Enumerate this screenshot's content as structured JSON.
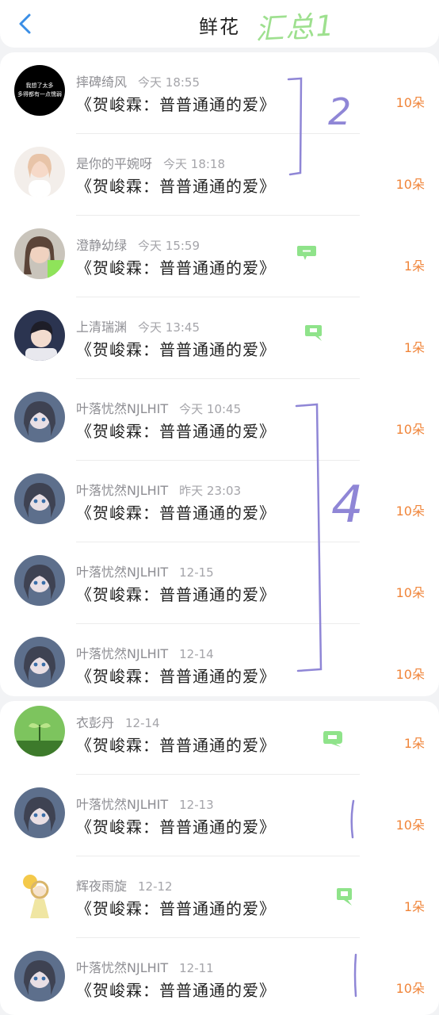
{
  "header": {
    "title": "鲜花",
    "back_icon": "chevron-left-icon",
    "annotation": "汇总1"
  },
  "annotations": {
    "group1": "2",
    "group2": "4",
    "single1": "1",
    "single2": "1"
  },
  "items": [
    {
      "name": "摔碑绮风",
      "time": "今天 18:55",
      "title": "《贺峻霖：普普通通的爱》",
      "count": "10朵",
      "avatar_text": "我想了太多\n多得都有一点懦弱",
      "chat_icon": false
    },
    {
      "name": "是你的平婉呀",
      "time": "今天 18:18",
      "title": "《贺峻霖：普普通通的爱》",
      "count": "10朵",
      "chat_icon": false
    },
    {
      "name": "澄静幼绿",
      "time": "今天 15:59",
      "title": "《贺峻霖：普普通通的爱》",
      "count": "1朵",
      "chat_icon": true
    },
    {
      "name": "上清瑞渊",
      "time": "今天 13:45",
      "title": "《贺峻霖：普普通通的爱》",
      "count": "1朵",
      "chat_icon": true
    },
    {
      "name": "叶落忧然NJLHIT",
      "time": "今天 10:45",
      "title": "《贺峻霖：普普通通的爱》",
      "count": "10朵",
      "chat_icon": false
    },
    {
      "name": "叶落忧然NJLHIT",
      "time": "昨天 23:03",
      "title": "《贺峻霖：普普通通的爱》",
      "count": "10朵",
      "chat_icon": false
    },
    {
      "name": "叶落忧然NJLHIT",
      "time": "12-15",
      "title": "《贺峻霖：普普通通的爱》",
      "count": "10朵",
      "chat_icon": false
    },
    {
      "name": "叶落忧然NJLHIT",
      "time": "12-14",
      "title": "《贺峻霖：普普通通的爱》",
      "count": "10朵",
      "chat_icon": false
    },
    {
      "name": "衣彭丹",
      "time": "12-14",
      "title": "《贺峻霖：普普通通的爱》",
      "count": "1朵",
      "chat_icon": true
    },
    {
      "name": "叶落忧然NJLHIT",
      "time": "12-13",
      "title": "《贺峻霖：普普通通的爱》",
      "count": "10朵",
      "chat_icon": false
    },
    {
      "name": "辉夜雨旋",
      "time": "12-12",
      "title": "《贺峻霖：普普通通的爱》",
      "count": "1朵",
      "chat_icon": true
    },
    {
      "name": "叶落忧然NJLHIT",
      "time": "12-11",
      "title": "《贺峻霖：普普通通的爱》",
      "count": "10朵",
      "chat_icon": false
    }
  ],
  "colors": {
    "count": "#f0853a",
    "annotation_green": "#9ee08f",
    "annotation_purple": "#8f86d6",
    "back": "#3a8ee6"
  }
}
